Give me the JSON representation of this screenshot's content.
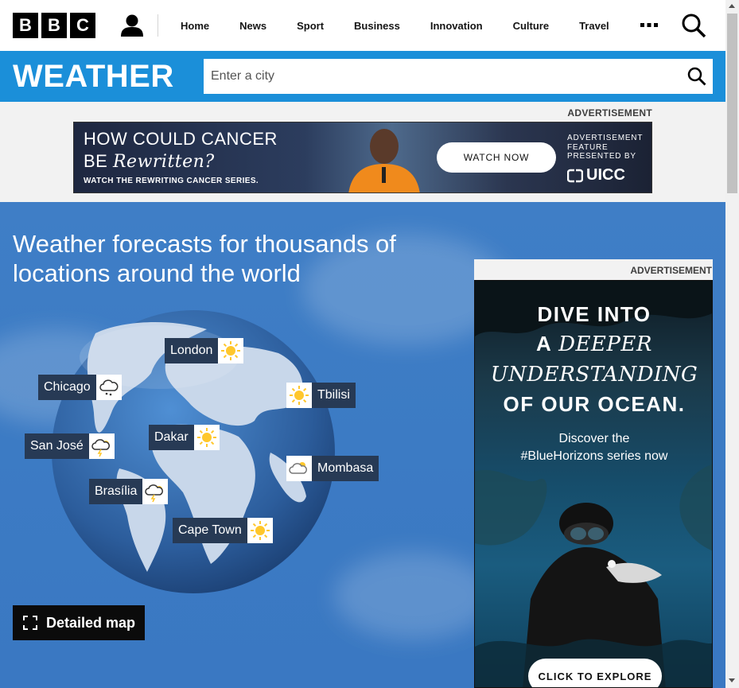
{
  "header": {
    "logo_letters": [
      "B",
      "B",
      "C"
    ],
    "nav": [
      "Home",
      "News",
      "Sport",
      "Business",
      "Innovation",
      "Culture",
      "Travel"
    ],
    "icons": {
      "account": "account-icon",
      "more": "more-icon",
      "search": "search-icon"
    }
  },
  "weather_bar": {
    "title": "WEATHER",
    "search_placeholder": "Enter a city",
    "search_button": "search-icon",
    "color": "#1b8fd9"
  },
  "top_ad": {
    "label": "ADVERTISEMENT",
    "line1": "HOW COULD CANCER",
    "line2_prefix": "BE",
    "line2_script": "Rewritten?",
    "subline": "WATCH THE REWRITING CANCER SERIES.",
    "cta": "WATCH NOW",
    "feature_lines": [
      "ADVERTISEMENT",
      "FEATURE",
      "PRESENTED BY"
    ],
    "sponsor": "UICC"
  },
  "main": {
    "headline": "Weather forecasts for thousands of locations around the world",
    "cities": [
      {
        "name": "London",
        "icon": "sunny-icon"
      },
      {
        "name": "Chicago",
        "icon": "cloud-hail-icon"
      },
      {
        "name": "Tbilisi",
        "icon": "sunny-icon"
      },
      {
        "name": "Dakar",
        "icon": "sunny-icon"
      },
      {
        "name": "San José",
        "icon": "thunderstorm-sun-icon"
      },
      {
        "name": "Mombasa",
        "icon": "cloud-icon"
      },
      {
        "name": "Brasília",
        "icon": "thunderstorm-sun-icon"
      },
      {
        "name": "Cape Town",
        "icon": "sunny-icon"
      }
    ],
    "detailed_map_label": "Detailed map",
    "background_color": "#3c7bc4"
  },
  "side_ad": {
    "label": "ADVERTISEMENT",
    "headline_lines": [
      "DIVE INTO",
      "A",
      "DEEPER",
      "UNDERSTANDING",
      "OF OUR OCEAN."
    ],
    "subtext_lines": [
      "Discover the",
      "#BlueHorizons series now"
    ],
    "cta": "CLICK TO EXPLORE"
  }
}
